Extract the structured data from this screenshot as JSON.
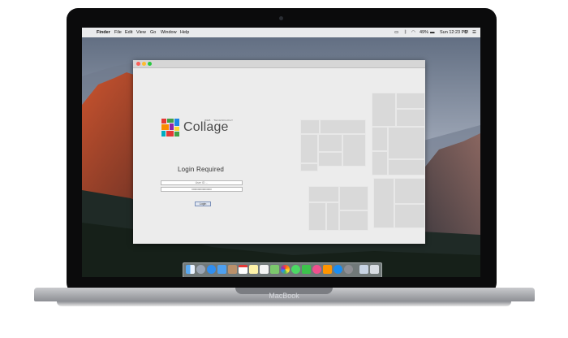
{
  "device": {
    "brand_label": "MacBook"
  },
  "menubar": {
    "app_name": "Finder",
    "items": [
      "File",
      "Edit",
      "View",
      "Go",
      "Window",
      "Help"
    ],
    "battery": "49%",
    "clock": "Sun 12:23 PM"
  },
  "login_window": {
    "logo_text": "Collage",
    "logo_tagline": "WEB · TECHNOLOGY",
    "heading": "Login Required",
    "user_placeholder": "User ID ...",
    "password_value": "••••••••••••••••••••",
    "login_button_label": "Login"
  },
  "colors": {
    "window_bg": "#ececec",
    "tile_gray": "#d9d9d9",
    "menubar_bg": "#f5f5f5",
    "laptop_bezel": "#0b0b0c"
  },
  "dock": {
    "icons": [
      "finder-icon",
      "launchpad-icon",
      "safari-icon",
      "mail-icon",
      "contacts-icon",
      "calendar-icon",
      "notes-icon",
      "reminders-icon",
      "maps-icon",
      "photos-icon",
      "messages-icon",
      "facetime-icon",
      "itunes-icon",
      "ibooks-icon",
      "app-store-icon",
      "system-preferences-icon",
      "downloads-icon",
      "trash-icon"
    ]
  }
}
